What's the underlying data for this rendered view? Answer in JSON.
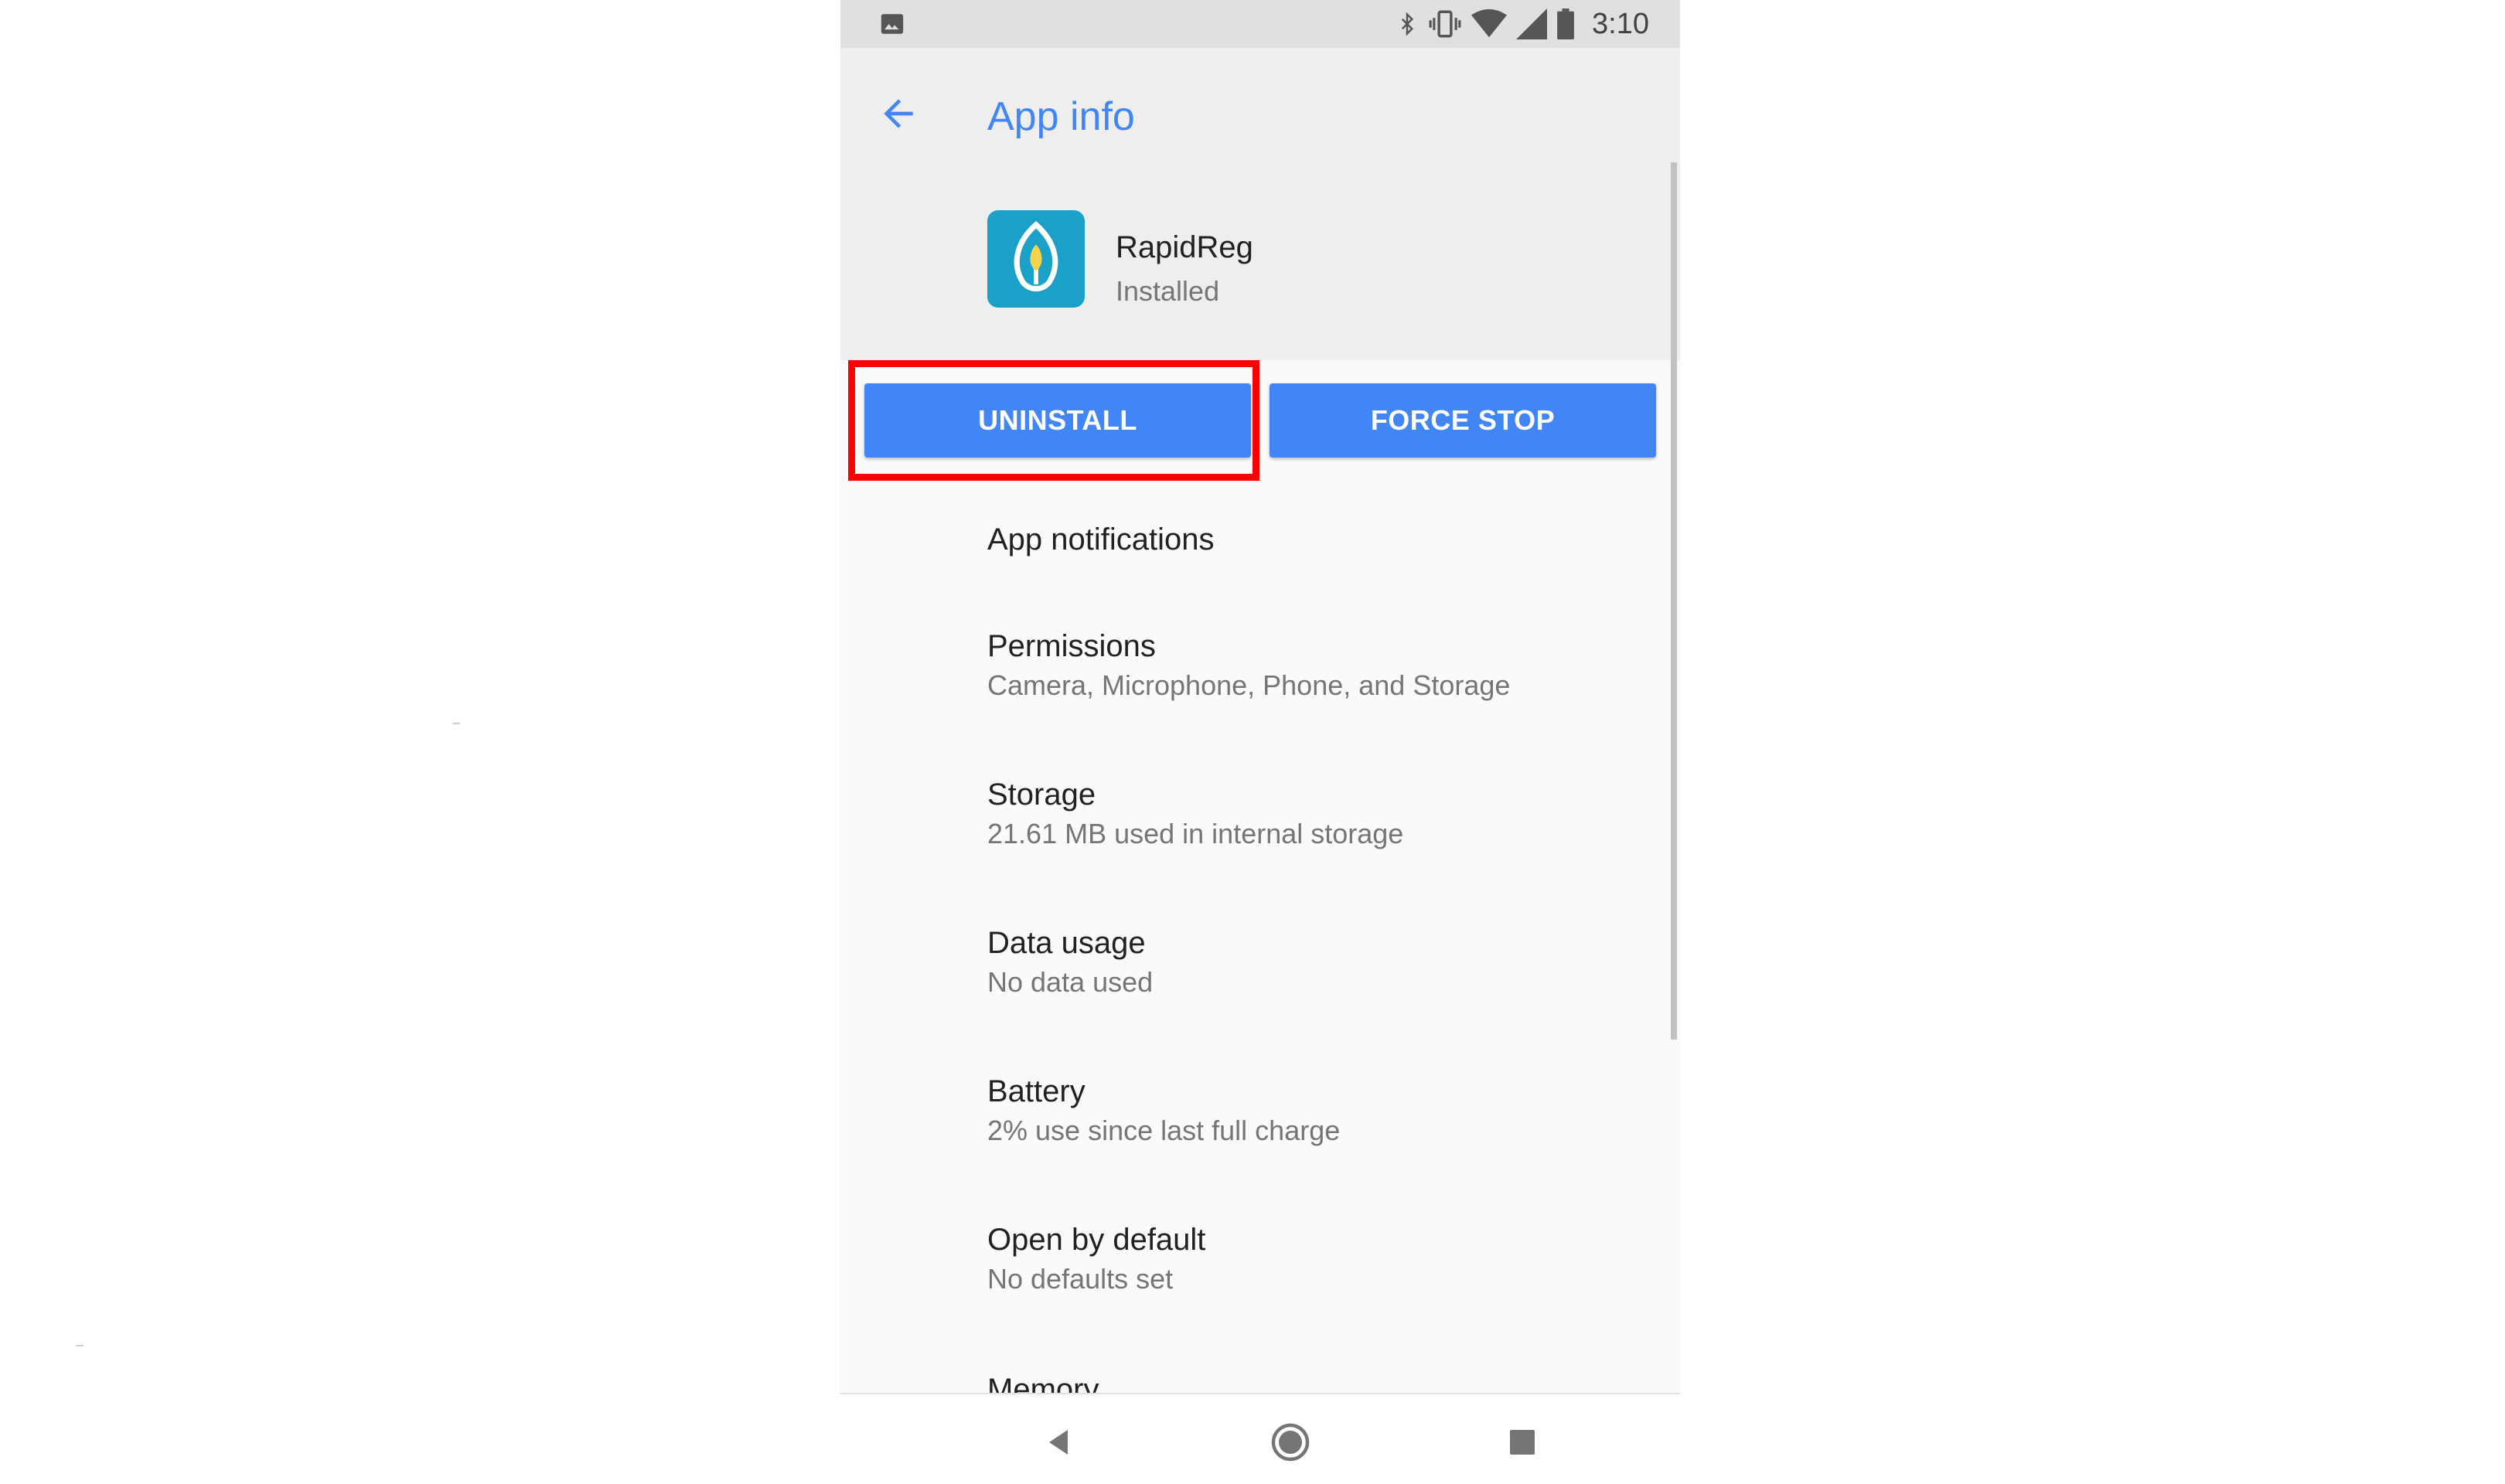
{
  "status_bar": {
    "time": "3:10",
    "icons": [
      "image-notification-icon",
      "bluetooth-icon",
      "vibrate-icon",
      "wifi-icon",
      "cell-signal-icon",
      "battery-icon"
    ]
  },
  "app_bar": {
    "title": "App info",
    "back_icon": "arrow-back-icon"
  },
  "app": {
    "name": "RapidReg",
    "status": "Installed",
    "icon": "rapidreg-app-icon"
  },
  "actions": {
    "uninstall_label": "UNINSTALL",
    "force_stop_label": "FORCE STOP"
  },
  "settings": [
    {
      "title": "App notifications",
      "subtitle": ""
    },
    {
      "title": "Permissions",
      "subtitle": "Camera, Microphone, Phone, and Storage"
    },
    {
      "title": "Storage",
      "subtitle": "21.61 MB used in internal storage"
    },
    {
      "title": "Data usage",
      "subtitle": "No data used"
    },
    {
      "title": "Battery",
      "subtitle": "2% use since last full charge"
    },
    {
      "title": "Open by default",
      "subtitle": "No defaults set"
    },
    {
      "title": "Memory",
      "subtitle": ""
    }
  ],
  "nav_bar": {
    "back": "nav-back-icon",
    "home": "nav-home-icon",
    "recents": "nav-recents-icon"
  },
  "colors": {
    "accent": "#4285f4",
    "highlight": "#ff0000",
    "app_icon_bg": "#1ba0c8"
  }
}
